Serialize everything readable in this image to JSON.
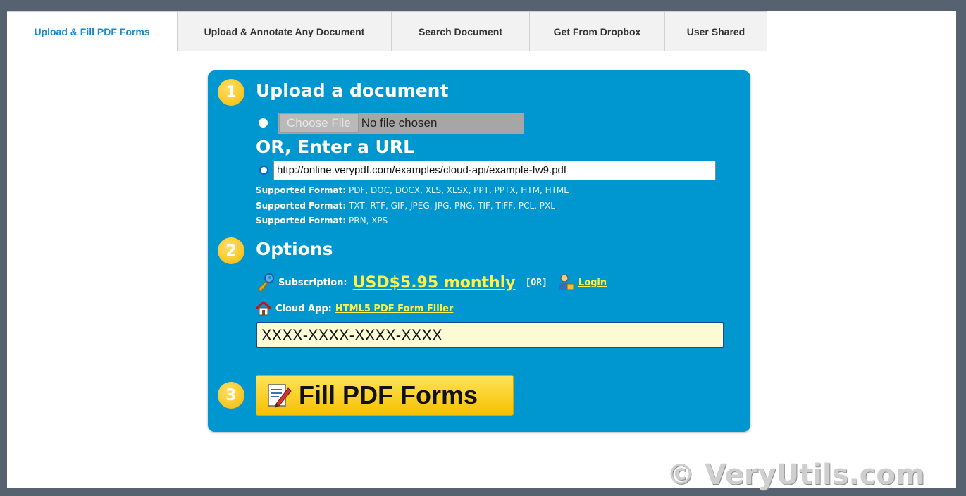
{
  "tabs": [
    {
      "label": "Upload & Fill PDF Forms",
      "active": true
    },
    {
      "label": "Upload & Annotate Any Document",
      "active": false
    },
    {
      "label": "Search Document",
      "active": false
    },
    {
      "label": "Get From Dropbox",
      "active": false
    },
    {
      "label": "User Shared",
      "active": false
    }
  ],
  "step1": {
    "number": "1",
    "title": "Upload a document",
    "choose_file_label": "Choose File",
    "file_status": "No file chosen",
    "or_url_title": "OR, Enter a URL",
    "url_value": "http://online.verypdf.com/examples/cloud-api/example-fw9.pdf",
    "formats": [
      {
        "label": "Supported Format:",
        "values": "PDF, DOC, DOCX, XLS, XLSX, PPT, PPTX, HTM, HTML"
      },
      {
        "label": "Supported Format:",
        "values": "TXT, RTF, GIF, JPEG, JPG, PNG, TIF, TIFF, PCL, PXL"
      },
      {
        "label": "Supported Format:",
        "values": "PRN, XPS"
      }
    ]
  },
  "step2": {
    "number": "2",
    "title": "Options",
    "subscription_label": "Subscription:",
    "price_link": "USD$5.95 monthly",
    "or_text": "[OR]",
    "login_link": "Login",
    "cloud_app_label": "Cloud App:",
    "cloud_app_link": "HTML5 PDF Form Filler",
    "key_value": "XXXX-XXXX-XXXX-XXXX"
  },
  "step3": {
    "number": "3",
    "button_label": "Fill PDF Forms"
  },
  "watermark": "© VeryUtils.com",
  "colors": {
    "panel": "#0096cf",
    "accent_yellow": "#fff04a",
    "active_tab_text": "#1a8ac9",
    "background": "#56626f"
  },
  "icons": [
    "key-icon",
    "user-icon",
    "home-icon",
    "edit-form-icon"
  ]
}
